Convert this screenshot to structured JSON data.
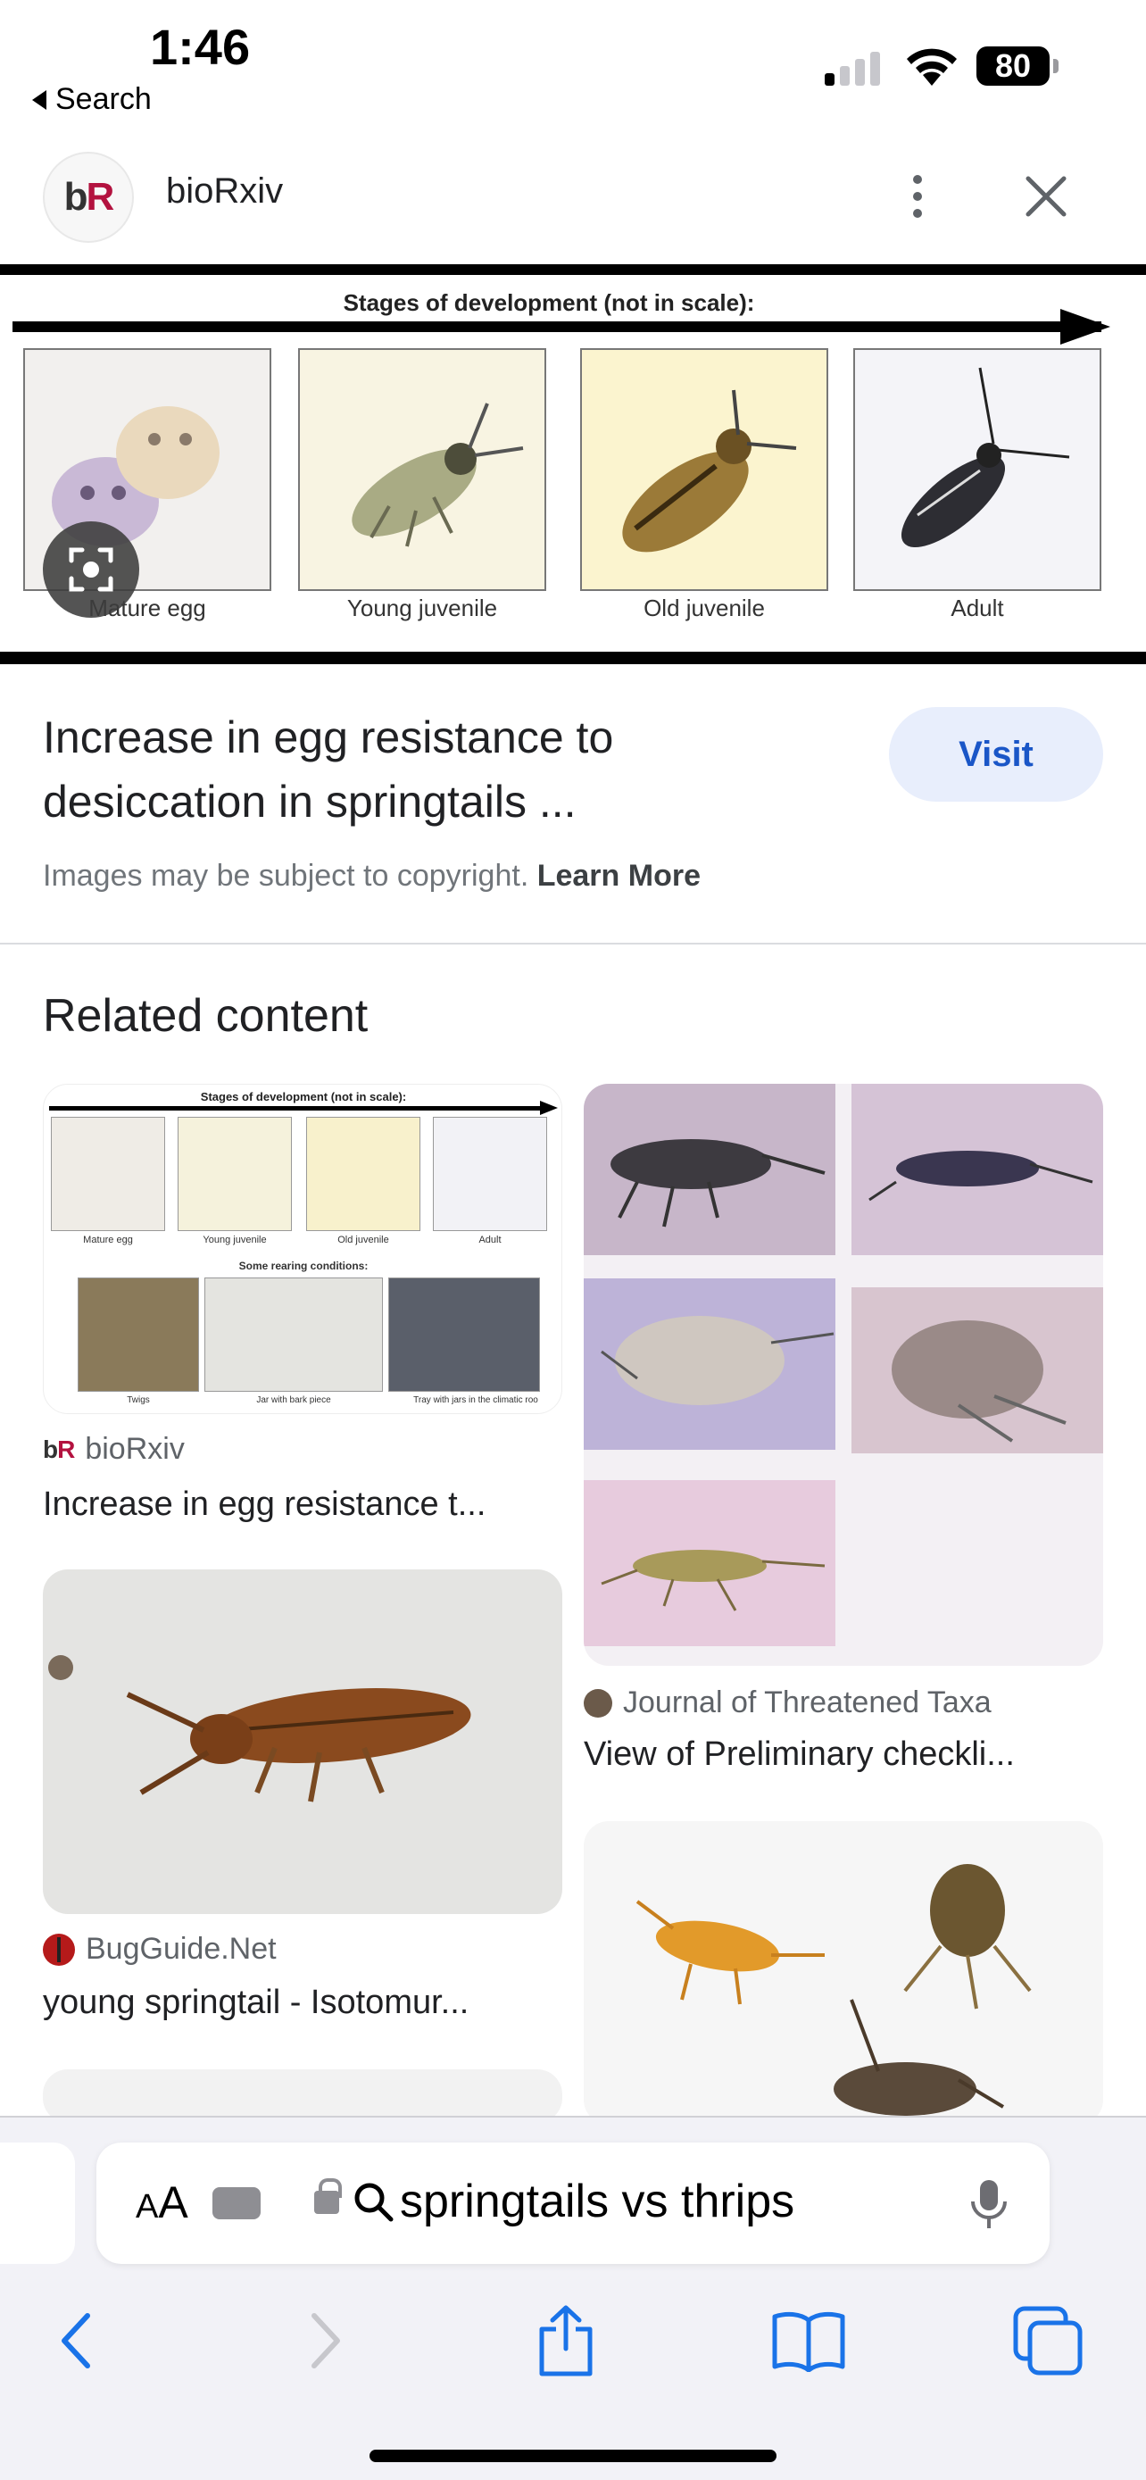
{
  "status_bar": {
    "time": "1:46",
    "back_label": "Search",
    "battery": "80"
  },
  "header": {
    "logo_b": "b",
    "logo_r": "R",
    "site_name": "bioRxiv"
  },
  "hero": {
    "title": "Stages of development (not in scale):",
    "stages": [
      "Mature egg",
      "Young juvenile",
      "Old juvenile",
      "Adult"
    ]
  },
  "result": {
    "title": "Increase in egg resistance to desiccation in springtails ...",
    "visit_label": "Visit",
    "copyright_text": "Images may be subject to copyright.",
    "learn_more": "Learn More"
  },
  "related": {
    "heading": "Related content",
    "cards": [
      {
        "source": "bioRxiv",
        "title": "Increase in egg resistance t..."
      },
      {
        "source": "Journal of Threatened Taxa",
        "title": "View of Preliminary checkli..."
      },
      {
        "source": "BugGuide.Net",
        "title": "young springtail - Isotomur..."
      }
    ],
    "card1_image": {
      "top_title": "Stages of development (not in scale):",
      "stages": [
        "Mature egg",
        "Young juvenile",
        "Old juvenile",
        "Adult"
      ],
      "rearing_title": "Some rearing conditions:",
      "rearing": [
        "Twigs",
        "Jar with bark piece",
        "Tray with jars in the climatic roo"
      ]
    }
  },
  "browser": {
    "aa_label": "AA",
    "url_text": "springtails vs thrips"
  },
  "colors": {
    "accent": "#1a56c7",
    "visit_bg": "#e8eefc",
    "logo_red": "#b3123f"
  }
}
